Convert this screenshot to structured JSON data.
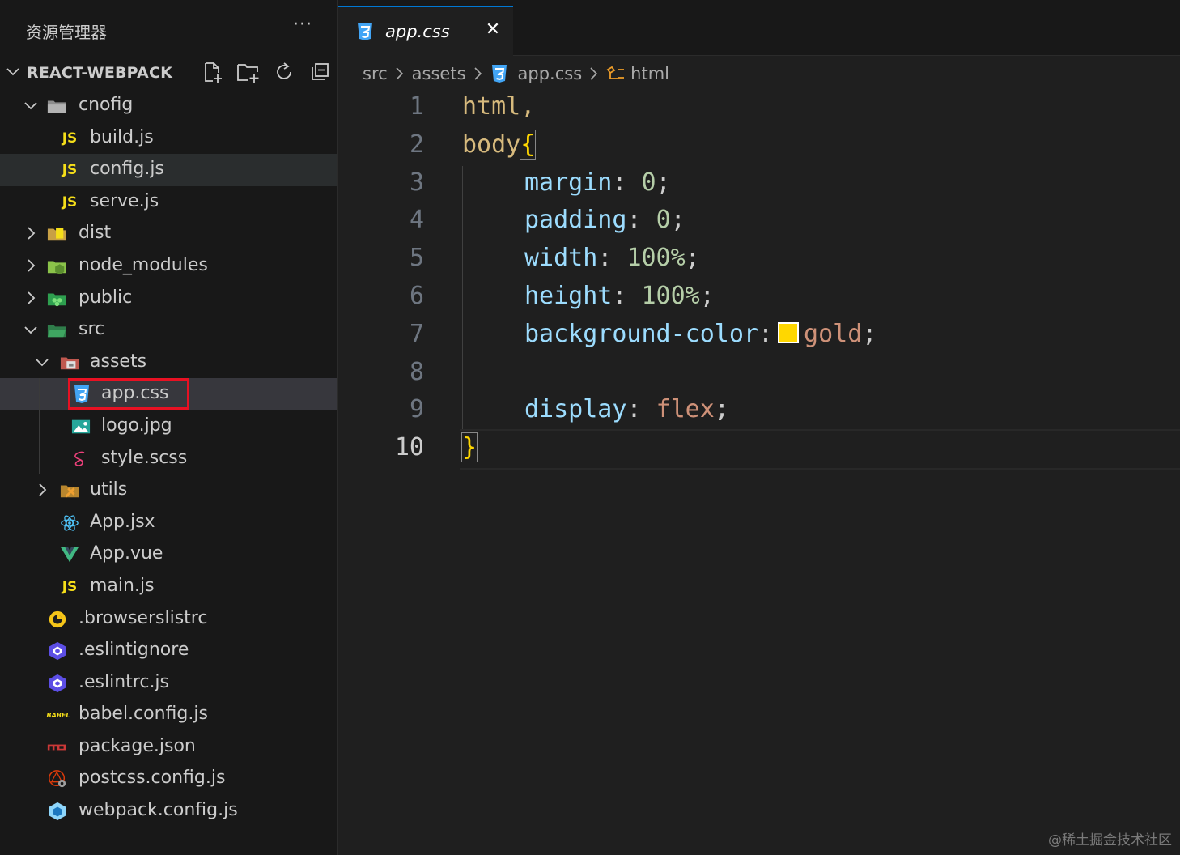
{
  "explorer": {
    "title": "资源管理器",
    "more": "···",
    "project": "REACT-WEBPACK",
    "actions": [
      "new-file-icon",
      "new-folder-icon",
      "refresh-icon",
      "collapse-all-icon"
    ],
    "items": [
      {
        "label": "cnofig",
        "type": "folder",
        "expanded": true,
        "depth": 1,
        "icon": "folder-config-icon"
      },
      {
        "label": "build.js",
        "type": "file",
        "depth": 2,
        "icon": "js-icon"
      },
      {
        "label": "config.js",
        "type": "file",
        "depth": 2,
        "icon": "js-icon"
      },
      {
        "label": "serve.js",
        "type": "file",
        "depth": 2,
        "icon": "js-icon"
      },
      {
        "label": "dist",
        "type": "folder",
        "expanded": false,
        "depth": 1,
        "icon": "folder-dist-icon"
      },
      {
        "label": "node_modules",
        "type": "folder",
        "expanded": false,
        "depth": 1,
        "icon": "folder-node-icon"
      },
      {
        "label": "public",
        "type": "folder",
        "expanded": false,
        "depth": 1,
        "icon": "folder-public-icon"
      },
      {
        "label": "src",
        "type": "folder",
        "expanded": true,
        "depth": 1,
        "icon": "folder-src-icon"
      },
      {
        "label": "assets",
        "type": "folder",
        "expanded": true,
        "depth": 2,
        "icon": "folder-assets-icon"
      },
      {
        "label": "app.css",
        "type": "file",
        "depth": 3,
        "icon": "css-icon",
        "selected": true
      },
      {
        "label": "logo.jpg",
        "type": "file",
        "depth": 3,
        "icon": "image-icon"
      },
      {
        "label": "style.scss",
        "type": "file",
        "depth": 3,
        "icon": "scss-icon"
      },
      {
        "label": "utils",
        "type": "folder",
        "expanded": false,
        "depth": 2,
        "icon": "folder-utils-icon"
      },
      {
        "label": "App.jsx",
        "type": "file",
        "depth": 2,
        "icon": "react-icon"
      },
      {
        "label": "App.vue",
        "type": "file",
        "depth": 2,
        "icon": "vue-icon"
      },
      {
        "label": "main.js",
        "type": "file",
        "depth": 2,
        "icon": "js-icon"
      },
      {
        "label": ".browserslistrc",
        "type": "file",
        "depth": 1,
        "icon": "browserslist-icon"
      },
      {
        "label": ".eslintignore",
        "type": "file",
        "depth": 1,
        "icon": "eslint-icon"
      },
      {
        "label": ".eslintrc.js",
        "type": "file",
        "depth": 1,
        "icon": "eslint-icon"
      },
      {
        "label": "babel.config.js",
        "type": "file",
        "depth": 1,
        "icon": "babel-icon"
      },
      {
        "label": "package.json",
        "type": "file",
        "depth": 1,
        "icon": "npm-icon"
      },
      {
        "label": "postcss.config.js",
        "type": "file",
        "depth": 1,
        "icon": "postcss-icon"
      },
      {
        "label": "webpack.config.js",
        "type": "file",
        "depth": 1,
        "icon": "webpack-icon"
      }
    ]
  },
  "editor": {
    "tab": {
      "label": "app.css",
      "close": "✕"
    },
    "breadcrumb": [
      "src",
      "assets",
      "app.css",
      "html"
    ],
    "lines": [
      {
        "n": "1",
        "text": "html,"
      },
      {
        "n": "2",
        "text": "body{"
      },
      {
        "n": "3",
        "text": "margin: 0;"
      },
      {
        "n": "4",
        "text": "padding: 0;"
      },
      {
        "n": "5",
        "text": "width: 100%;"
      },
      {
        "n": "6",
        "text": "height: 100%;"
      },
      {
        "n": "7",
        "text": "background-color: gold;"
      },
      {
        "n": "8",
        "text": ""
      },
      {
        "n": "9",
        "text": "display: flex;"
      },
      {
        "n": "10",
        "text": "}"
      }
    ],
    "active_line": "10",
    "swatch_color": "#ffd700"
  },
  "watermark": "@稀土掘金技术社区",
  "colors": {
    "accent": "#0078d4",
    "highlight_box": "#e81123",
    "selector": "#d7ba7d",
    "property": "#9cdcfe",
    "number": "#b5cea8",
    "value": "#ce9178"
  }
}
